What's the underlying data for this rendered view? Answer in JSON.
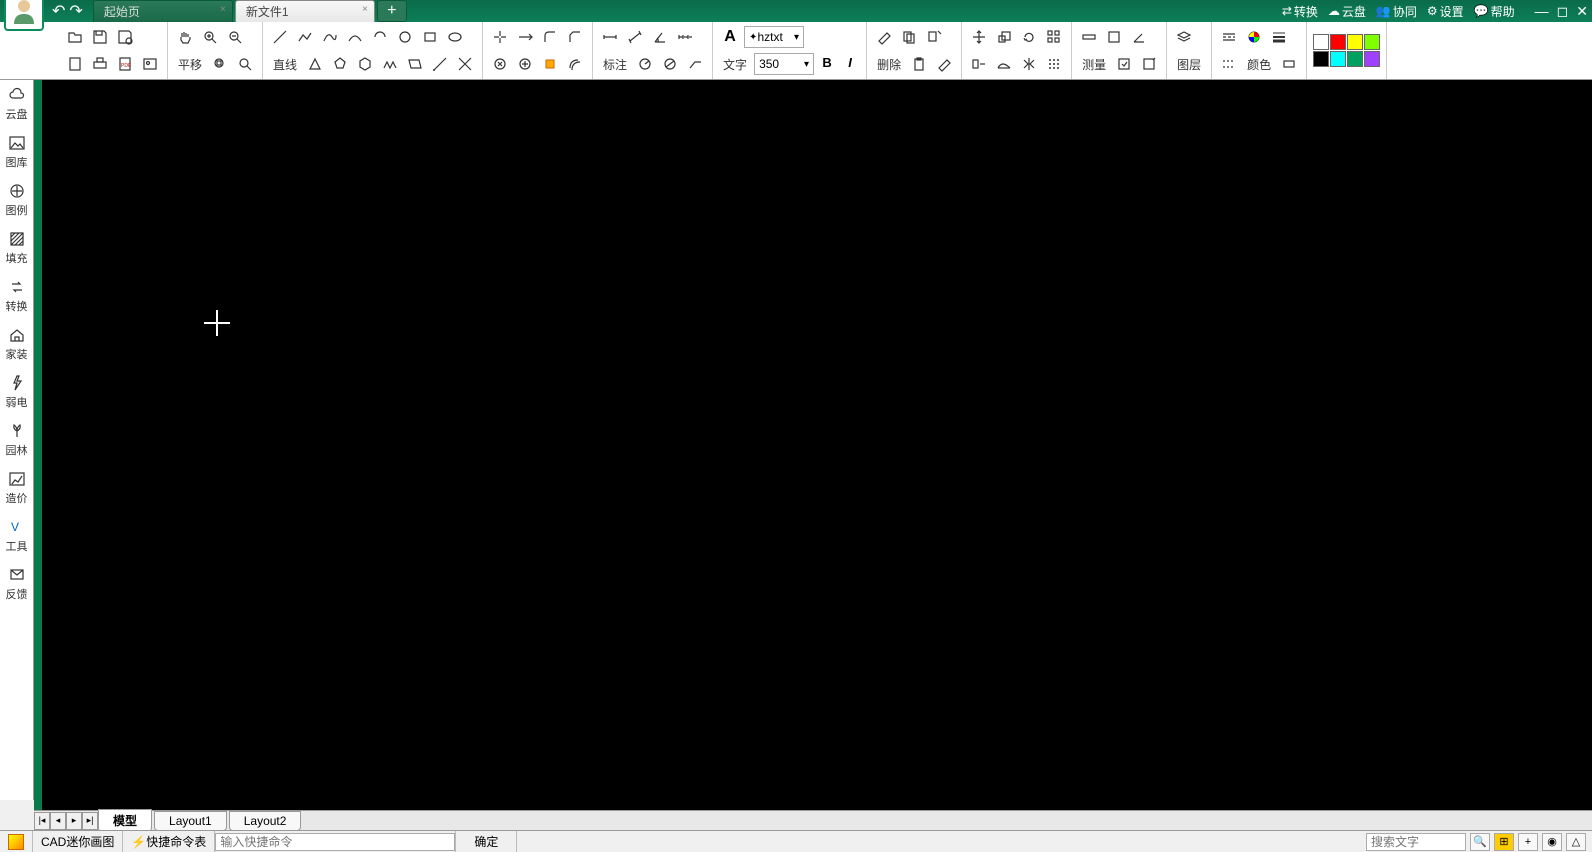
{
  "titlebar": {
    "tabs": [
      {
        "label": "起始页",
        "active": false
      },
      {
        "label": "新文件1",
        "active": true
      }
    ],
    "menu": {
      "convert": "转换",
      "cloud": "云盘",
      "collab": "协同",
      "settings": "设置",
      "help": "帮助"
    }
  },
  "toolbar": {
    "pan": "平移",
    "line": "直线",
    "annotate": "标注",
    "text": "文字",
    "font": "hztxt",
    "font_size": "350",
    "bold": "B",
    "italic": "I",
    "delete": "删除",
    "measure": "测量",
    "layer": "图层",
    "color": "颜色"
  },
  "sidebar": {
    "items": [
      {
        "label": "云盘",
        "icon": "cloud"
      },
      {
        "label": "图库",
        "icon": "gallery"
      },
      {
        "label": "图例",
        "icon": "legend"
      },
      {
        "label": "填充",
        "icon": "hatch"
      },
      {
        "label": "转换",
        "icon": "convert"
      },
      {
        "label": "家装",
        "icon": "home"
      },
      {
        "label": "弱电",
        "icon": "elec"
      },
      {
        "label": "园林",
        "icon": "garden"
      },
      {
        "label": "造价",
        "icon": "cost"
      },
      {
        "label": "工具",
        "icon": "tools"
      },
      {
        "label": "反馈",
        "icon": "feedback"
      }
    ]
  },
  "layout_tabs": [
    "模型",
    "Layout1",
    "Layout2"
  ],
  "statusbar": {
    "app": "CAD迷你画图",
    "shortcut": "快捷命令表",
    "cmd_placeholder": "输入快捷命令",
    "confirm": "确定",
    "search_placeholder": "搜索文字"
  },
  "colors": [
    "#ffffff",
    "#ff0000",
    "#ffff00",
    "#80ff00",
    "#000000",
    "#00ffff",
    "#00a000",
    "#a000ff"
  ]
}
